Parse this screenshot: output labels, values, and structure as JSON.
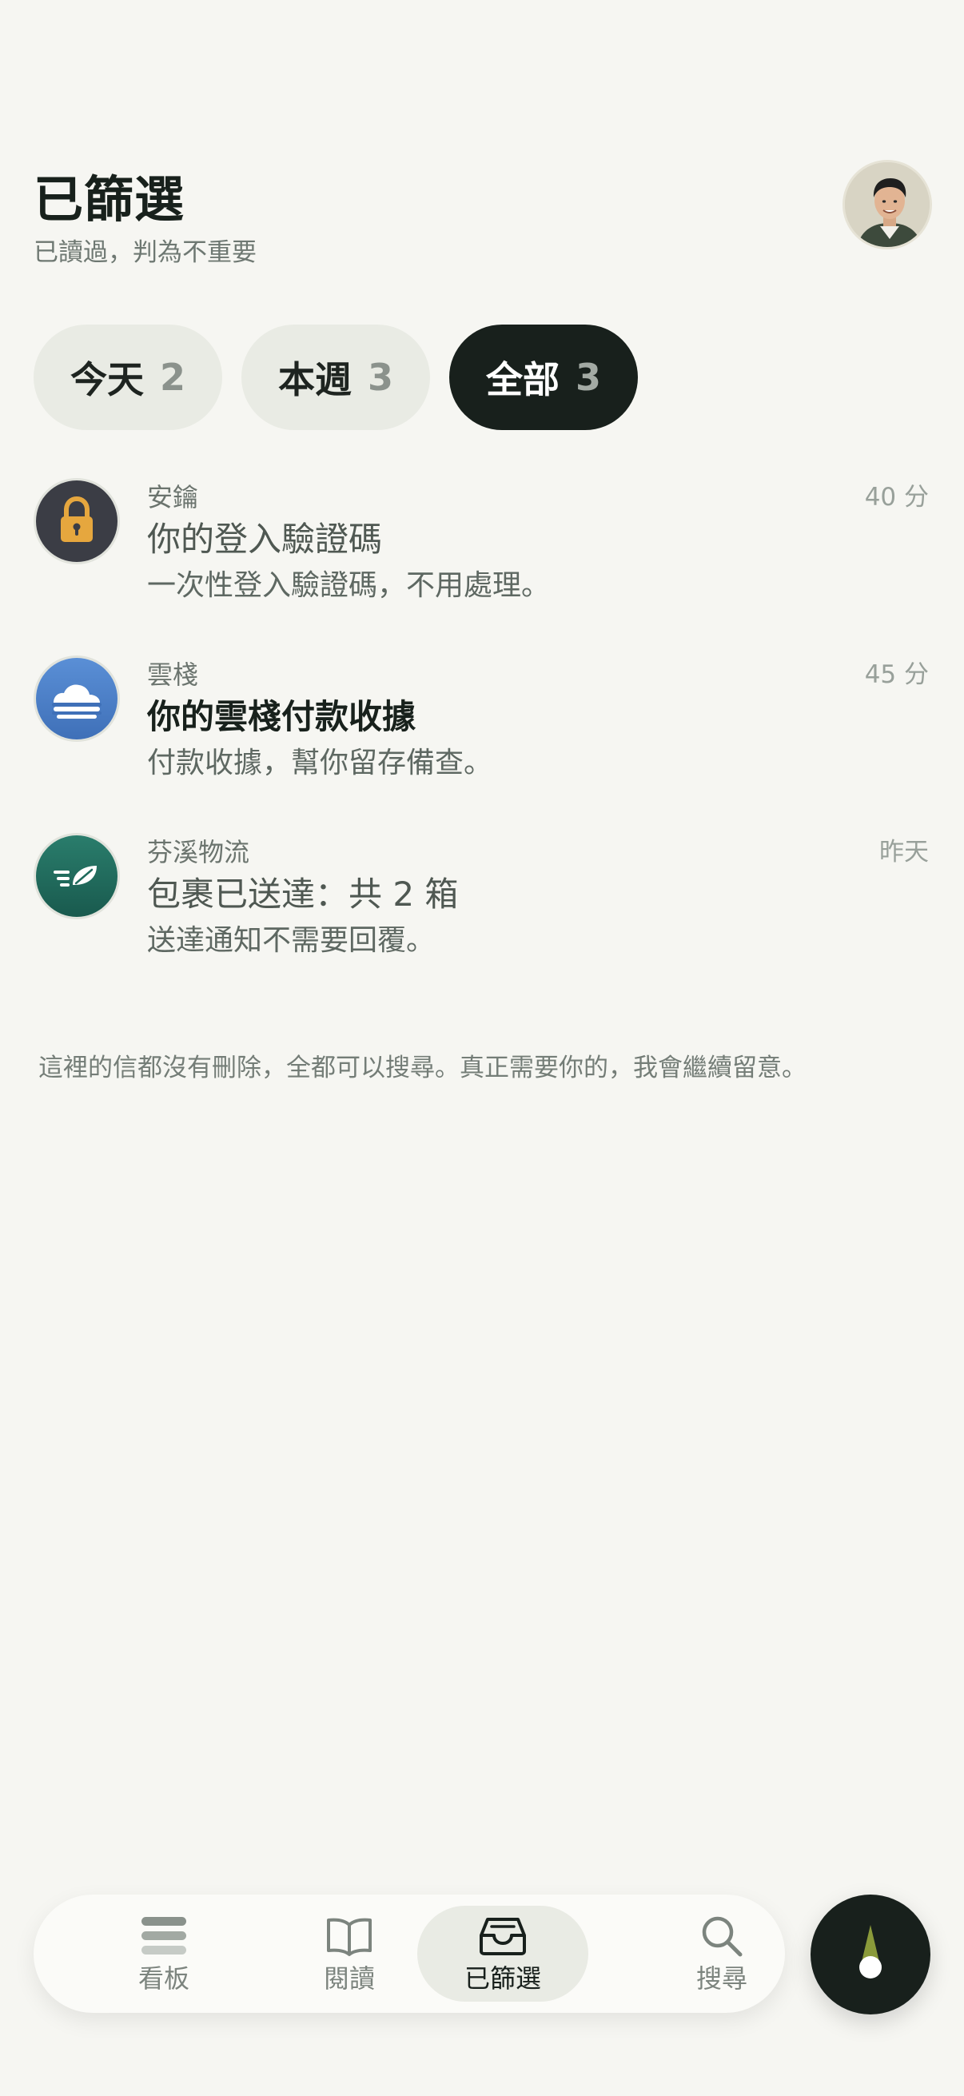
{
  "header": {
    "title": "已篩選",
    "subtitle": "已讀過，判為不重要"
  },
  "filters": [
    {
      "label": "今天",
      "count": "2",
      "active": false
    },
    {
      "label": "本週",
      "count": "3",
      "active": false
    },
    {
      "label": "全部",
      "count": "3",
      "active": true
    }
  ],
  "mails": [
    {
      "sender": "安鑰",
      "time": "40 分",
      "subject": "你的登入驗證碼",
      "preview": "一次性登入驗證碼，不用處理。",
      "icon": "lock-icon",
      "unread": false
    },
    {
      "sender": "雲棧",
      "time": "45 分",
      "subject": "你的雲棧付款收據",
      "preview": "付款收據，幫你留存備查。",
      "icon": "cloud-icon",
      "unread": true
    },
    {
      "sender": "芬溪物流",
      "time": "昨天",
      "subject": "包裹已送達：共 2 箱",
      "preview": "送達通知不需要回覆。",
      "icon": "leaf-delivery-icon",
      "unread": false
    }
  ],
  "footer_note": "這裡的信都沒有刪除，全都可以搜尋。真正需要你的，我會繼續留意。",
  "tabbar": {
    "items": [
      {
        "label": "看板",
        "icon": "board-icon",
        "active": false
      },
      {
        "label": "閱讀",
        "icon": "book-icon",
        "active": false
      },
      {
        "label": "已篩選",
        "icon": "inbox-tray-icon",
        "active": true
      },
      {
        "label": "搜尋",
        "icon": "search-icon",
        "active": false
      }
    ]
  },
  "colors": {
    "background": "#f6f6f2",
    "active_pill": "#18201c",
    "pill": "#e9ebe4",
    "lock_icon_bg": "#3b3d45",
    "lock_icon_fg": "#e6a73e",
    "cloud_icon_bg": "#4a7fc8",
    "leaf_icon_bg": "#1f6a5c",
    "compass_accent": "#8a9a3a"
  }
}
